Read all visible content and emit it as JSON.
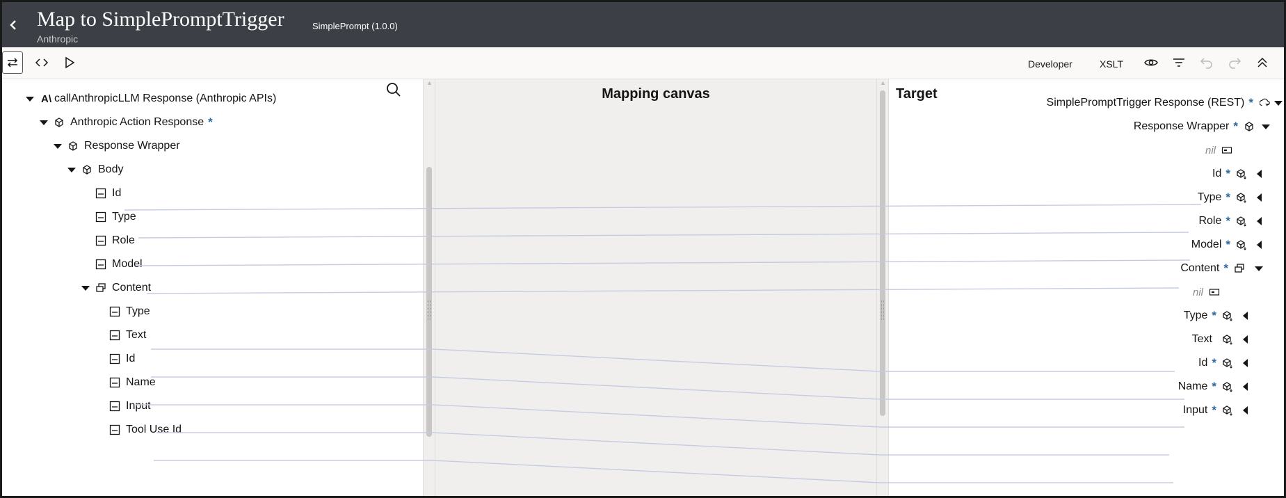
{
  "header": {
    "back_icon": "chevron-left-icon",
    "title": "Map to SimplePromptTrigger",
    "subtitle": "Anthropic",
    "version": "SimplePrompt (1.0.0)"
  },
  "toolbar": {
    "developer_label": "Developer",
    "xslt_label": "XSLT"
  },
  "source": {
    "root_label": "callAnthropicLLM Response (Anthropic APIs)",
    "action_response": "Anthropic Action Response",
    "required_mark": "*",
    "response_wrapper": "Response Wrapper",
    "body": "Body",
    "body_fields": [
      "Id",
      "Type",
      "Role",
      "Model"
    ],
    "content": "Content",
    "content_fields": [
      "Type",
      "Text",
      "Id",
      "Name",
      "Input",
      "Tool Use Id"
    ]
  },
  "canvas": {
    "title": "Mapping canvas"
  },
  "target": {
    "title": "Target",
    "root_label": "SimplePromptTrigger Response (REST)",
    "required_mark": "*",
    "response_wrapper": "Response Wrapper",
    "nil_label": "nil",
    "body_fields": [
      "Id",
      "Type",
      "Role",
      "Model"
    ],
    "content": "Content",
    "content_nil_label": "nil",
    "content_fields": [
      {
        "label": "Type",
        "required": "*"
      },
      {
        "label": "Text",
        "required": ""
      },
      {
        "label": "Id",
        "required": "*"
      },
      {
        "label": "Name",
        "required": "*"
      },
      {
        "label": "Input",
        "required": "*"
      }
    ]
  },
  "colors": {
    "header_bg": "#3c4046",
    "canvas_bg": "#f1efed",
    "line": "#c5cbe0",
    "required": "#2d6aa0"
  }
}
